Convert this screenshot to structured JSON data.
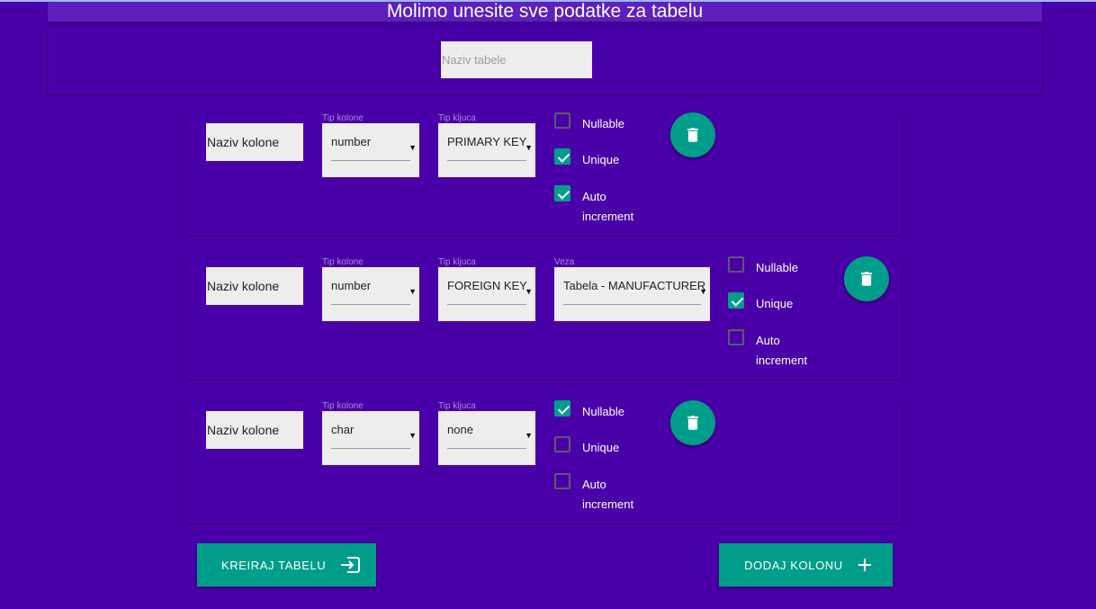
{
  "header": {
    "title": "Molimo unesite sve podatke za tabelu"
  },
  "table": {
    "name_placeholder": "Naziv tabele",
    "name_value": ""
  },
  "labels": {
    "column_name_placeholder": "Naziv kolone",
    "column_type": "Tip kolone",
    "key_type": "Tip kljuca",
    "relation": "Veza",
    "nullable": "Nullable",
    "unique": "Unique",
    "auto_line1": "Auto",
    "auto_line2": "increment"
  },
  "columns": [
    {
      "name": "",
      "type": "number",
      "key": "PRIMARY KEY",
      "nullable": false,
      "unique": true,
      "auto_increment": true
    },
    {
      "name": "",
      "type": "number",
      "key": "FOREIGN KEY",
      "relation": "Tabela - MANUFACTURER",
      "nullable": false,
      "unique": true,
      "auto_increment": false
    },
    {
      "name": "",
      "type": "char",
      "key": "none",
      "nullable": true,
      "unique": false,
      "auto_increment": false
    }
  ],
  "actions": {
    "create_table": "KREIRAJ TABELU",
    "add_column": "DODAJ KOLONU"
  },
  "icons": {
    "delete": "trash-icon",
    "create": "exit-to-app-icon",
    "add": "plus-icon"
  },
  "colors": {
    "background": "#4a00a8",
    "header": "#5d1fbf",
    "accent": "#009e8a",
    "field": "#ededed"
  }
}
